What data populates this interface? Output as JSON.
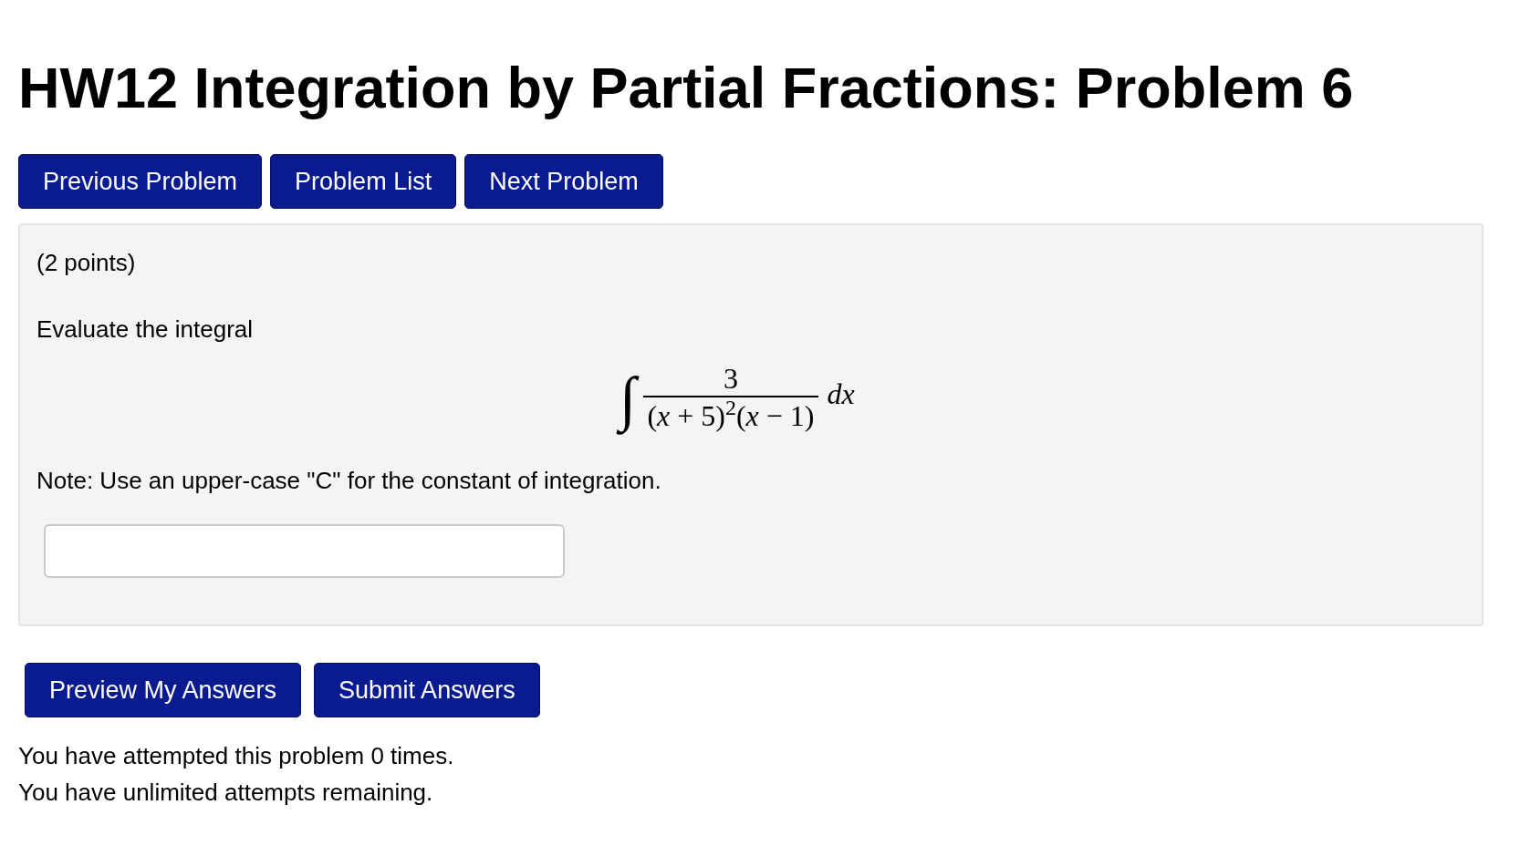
{
  "title": "HW12 Integration by Partial Fractions: Problem 6",
  "nav_buttons": [
    "Previous Problem",
    "Problem List",
    "Next Problem"
  ],
  "problem": {
    "points": "(2 points)",
    "prompt": "Evaluate the integral",
    "formula": {
      "integral_sign": "∫",
      "numerator": "3",
      "denominator": "(*x* + 5)$^{2}$(*x* − 1)",
      "differential": "*dx*"
    },
    "note": "Note: Use an upper-case \"C\" for the constant of integration."
  },
  "action_buttons": [
    "Preview My Answers",
    "Submit Answers"
  ],
  "attempts": [
    "You have attempted this problem 0 times.",
    "You have unlimited attempts remaining."
  ]
}
